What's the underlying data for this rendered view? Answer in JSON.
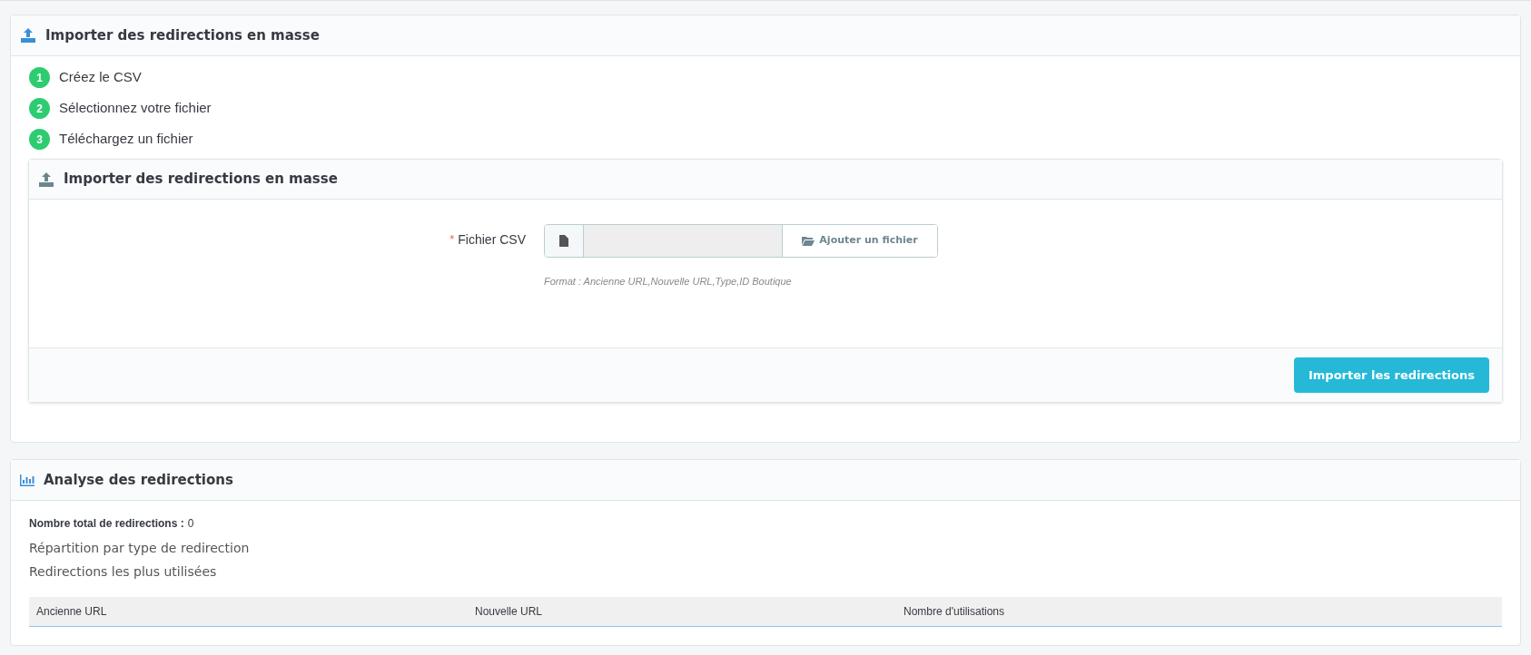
{
  "import_panel": {
    "title": "Importer des redirections en masse",
    "steps": [
      {
        "number": "1",
        "label": "Créez le CSV"
      },
      {
        "number": "2",
        "label": "Sélectionnez votre fichier"
      },
      {
        "number": "3",
        "label": "Téléchargez un fichier"
      }
    ],
    "form": {
      "title": "Importer des redirections en masse",
      "required_mark": "*",
      "field_label": "Fichier CSV",
      "add_file_button": "Ajouter un fichier",
      "help": "Format : Ancienne URL,Nouvelle URL,Type,ID Boutique",
      "submit_button": "Importer les redirections"
    }
  },
  "analysis_panel": {
    "title": "Analyse des redirections",
    "total_label": "Nombre total de redirections :",
    "total_value": "0",
    "section_1": "Répartition par type de redirection",
    "section_2": "Redirections les plus utilisées",
    "table": {
      "columns": [
        "Ancienne URL",
        "Nouvelle URL",
        "Nombre d'utilisations"
      ]
    }
  }
}
